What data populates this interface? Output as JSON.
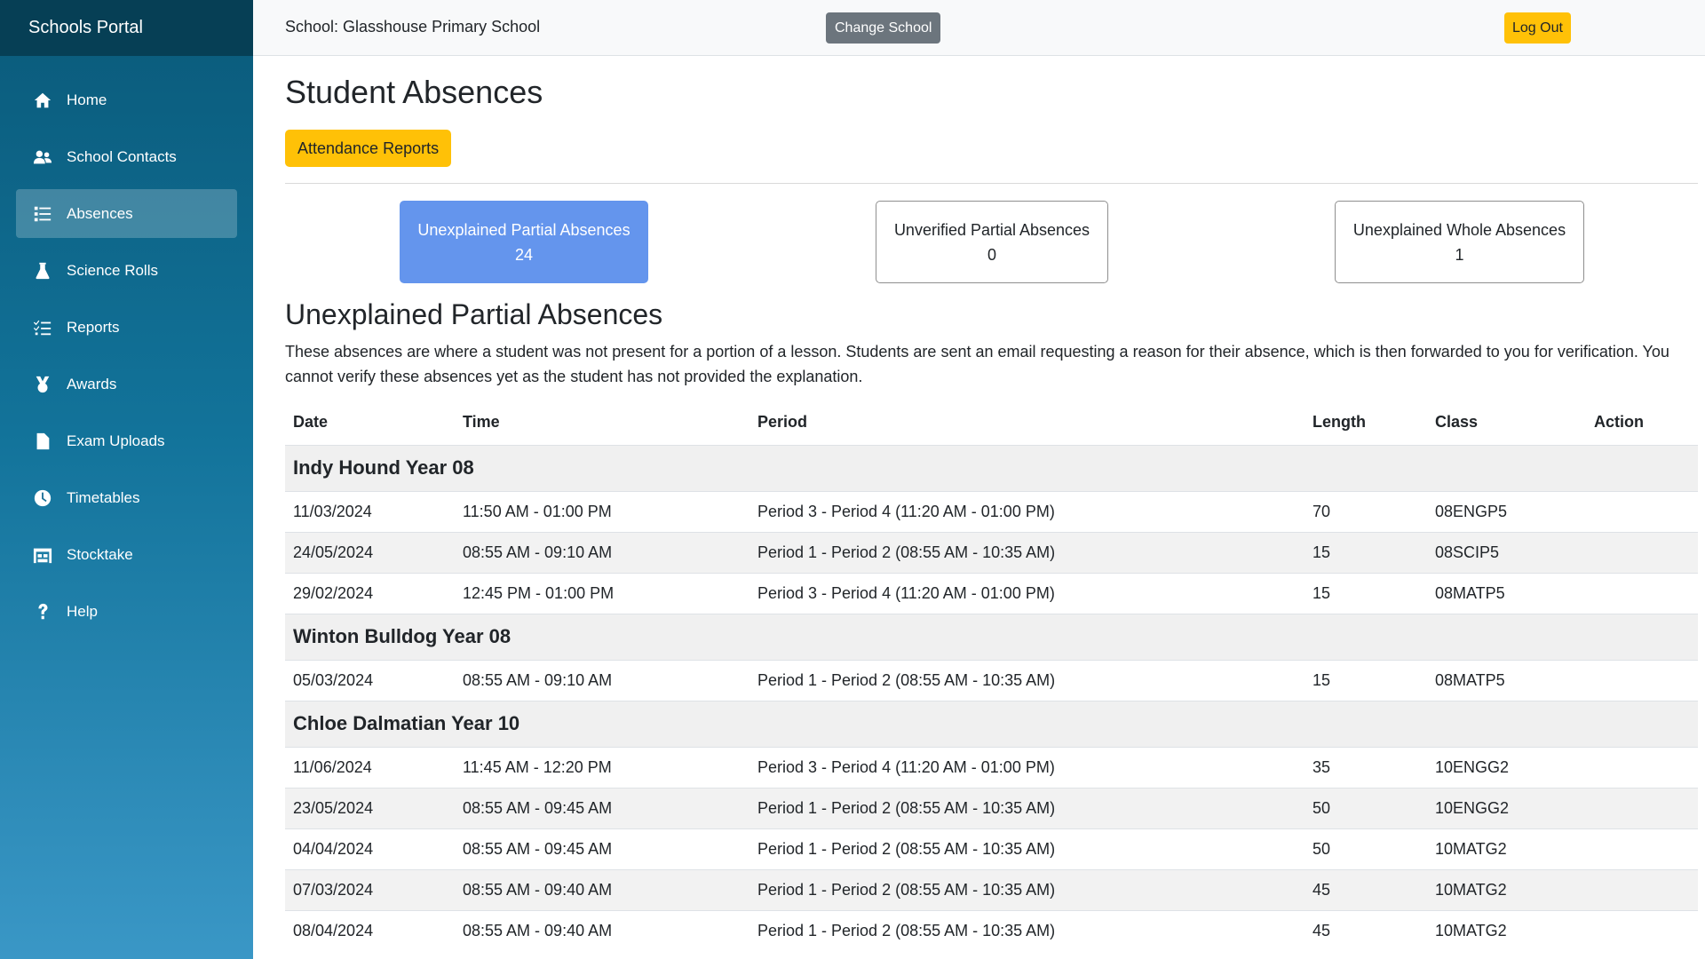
{
  "sidebar": {
    "brand": "Schools Portal",
    "items": [
      {
        "label": "Home",
        "icon": "home-icon"
      },
      {
        "label": "School Contacts",
        "icon": "users-icon"
      },
      {
        "label": "Absences",
        "icon": "list-icon",
        "active": true
      },
      {
        "label": "Science Rolls",
        "icon": "flask-icon"
      },
      {
        "label": "Reports",
        "icon": "checklist-icon"
      },
      {
        "label": "Awards",
        "icon": "medal-icon"
      },
      {
        "label": "Exam Uploads",
        "icon": "file-icon"
      },
      {
        "label": "Timetables",
        "icon": "clock-icon"
      },
      {
        "label": "Stocktake",
        "icon": "warehouse-icon"
      },
      {
        "label": "Help",
        "icon": "question-icon"
      }
    ]
  },
  "topbar": {
    "school_label": "School: Glasshouse Primary School",
    "change_school": "Change School",
    "log_out": "Log Out"
  },
  "main": {
    "title": "Student Absences",
    "attendance_reports": "Attendance Reports",
    "cards": [
      {
        "label": "Unexplained Partial Absences",
        "count": "24",
        "active": true
      },
      {
        "label": "Unverified Partial Absences",
        "count": "0"
      },
      {
        "label": "Unexplained Whole Absences",
        "count": "1"
      }
    ],
    "section_title": "Unexplained Partial Absences",
    "description": "These absences are where a student was not present for a portion of a lesson. Students are sent an email requesting a reason for their absence, which is then forwarded to you for verification. You cannot verify these absences yet as the student has not provided the explanation.",
    "table": {
      "headers": [
        "Date",
        "Time",
        "Period",
        "Length",
        "Class",
        "Action"
      ],
      "groups": [
        {
          "student": "Indy Hound Year 08",
          "rows": [
            {
              "date": "11/03/2024",
              "time": "11:50 AM - 01:00 PM",
              "period": "Period 3 - Period 4 (11:20 AM - 01:00 PM)",
              "length": "70",
              "class": "08ENGP5",
              "action": ""
            },
            {
              "date": "24/05/2024",
              "time": "08:55 AM - 09:10 AM",
              "period": "Period 1 - Period 2 (08:55 AM - 10:35 AM)",
              "length": "15",
              "class": "08SCIP5",
              "action": ""
            },
            {
              "date": "29/02/2024",
              "time": "12:45 PM - 01:00 PM",
              "period": "Period 3 - Period 4 (11:20 AM - 01:00 PM)",
              "length": "15",
              "class": "08MATP5",
              "action": ""
            }
          ]
        },
        {
          "student": "Winton Bulldog Year 08",
          "rows": [
            {
              "date": "05/03/2024",
              "time": "08:55 AM - 09:10 AM",
              "period": "Period 1 - Period 2 (08:55 AM - 10:35 AM)",
              "length": "15",
              "class": "08MATP5",
              "action": ""
            }
          ]
        },
        {
          "student": "Chloe Dalmatian Year 10",
          "rows": [
            {
              "date": "11/06/2024",
              "time": "11:45 AM - 12:20 PM",
              "period": "Period 3 - Period 4 (11:20 AM - 01:00 PM)",
              "length": "35",
              "class": "10ENGG2",
              "action": ""
            },
            {
              "date": "23/05/2024",
              "time": "08:55 AM - 09:45 AM",
              "period": "Period 1 - Period 2 (08:55 AM - 10:35 AM)",
              "length": "50",
              "class": "10ENGG2",
              "action": ""
            },
            {
              "date": "04/04/2024",
              "time": "08:55 AM - 09:45 AM",
              "period": "Period 1 - Period 2 (08:55 AM - 10:35 AM)",
              "length": "50",
              "class": "10MATG2",
              "action": ""
            },
            {
              "date": "07/03/2024",
              "time": "08:55 AM - 09:40 AM",
              "period": "Period 1 - Period 2 (08:55 AM - 10:35 AM)",
              "length": "45",
              "class": "10MATG2",
              "action": ""
            },
            {
              "date": "08/04/2024",
              "time": "08:55 AM - 09:40 AM",
              "period": "Period 1 - Period 2 (08:55 AM - 10:35 AM)",
              "length": "45",
              "class": "10MATG2",
              "action": ""
            }
          ]
        }
      ]
    }
  },
  "colors": {
    "sidebar_top": "#063f55",
    "accent_yellow": "#ffc107",
    "active_card": "#6495ed",
    "secondary_button": "#6c757d"
  }
}
